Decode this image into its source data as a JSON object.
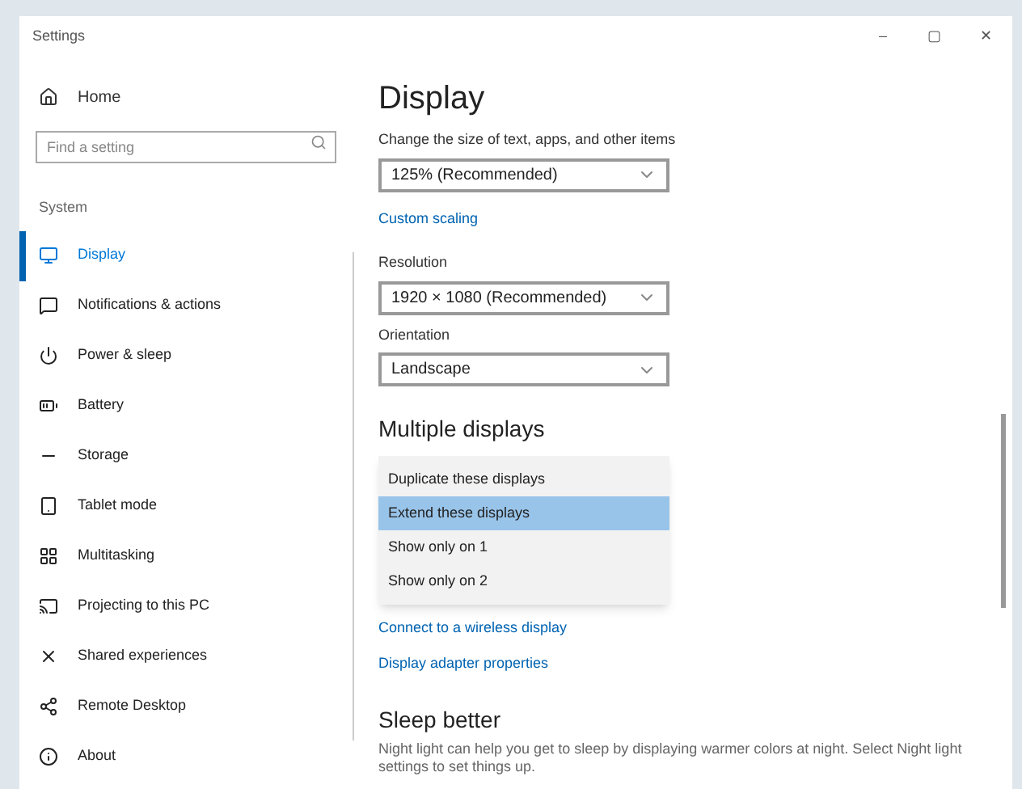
{
  "window": {
    "title": "Settings",
    "controls": [
      "–",
      "▢",
      "✕"
    ]
  },
  "sidebar": {
    "home": "Home",
    "search": {
      "placeholder": "Find a setting"
    },
    "section": "System",
    "items": [
      {
        "label": "Display",
        "selected": true
      },
      {
        "label": "Notifications & actions",
        "selected": false
      },
      {
        "label": "Power & sleep",
        "selected": false
      },
      {
        "label": "Battery",
        "selected": false
      },
      {
        "label": "Storage",
        "selected": false
      },
      {
        "label": "Tablet mode",
        "selected": false
      },
      {
        "label": "Multitasking",
        "selected": false
      },
      {
        "label": "Projecting to this PC",
        "selected": false
      },
      {
        "label": "Shared experiences",
        "selected": false
      },
      {
        "label": "Remote Desktop",
        "selected": false
      },
      {
        "label": "About",
        "selected": false
      }
    ]
  },
  "content": {
    "title": "Display",
    "scale": {
      "label": "Change the size of text, apps, and other items",
      "value": "125% (Recommended)"
    },
    "custom_scaling": "Custom scaling",
    "resolution": {
      "label": "Resolution",
      "value": "1920 × 1080 (Recommended)"
    },
    "orientation": {
      "label": "Orientation",
      "value": "Landscape"
    },
    "multiple_displays": {
      "title": "Multiple displays",
      "options": [
        {
          "label": "Duplicate these displays",
          "selected": false
        },
        {
          "label": "Extend these displays",
          "selected": true
        },
        {
          "label": "Show only on 1",
          "selected": false
        },
        {
          "label": "Show only on 2",
          "selected": false
        }
      ]
    },
    "links": [
      "Connect to a wireless display",
      "Display adapter properties"
    ],
    "sleep": {
      "title": "Sleep better",
      "text": "Night light can help you get to sleep by displaying warmer colors at night. Select Night light settings to set things up."
    }
  }
}
